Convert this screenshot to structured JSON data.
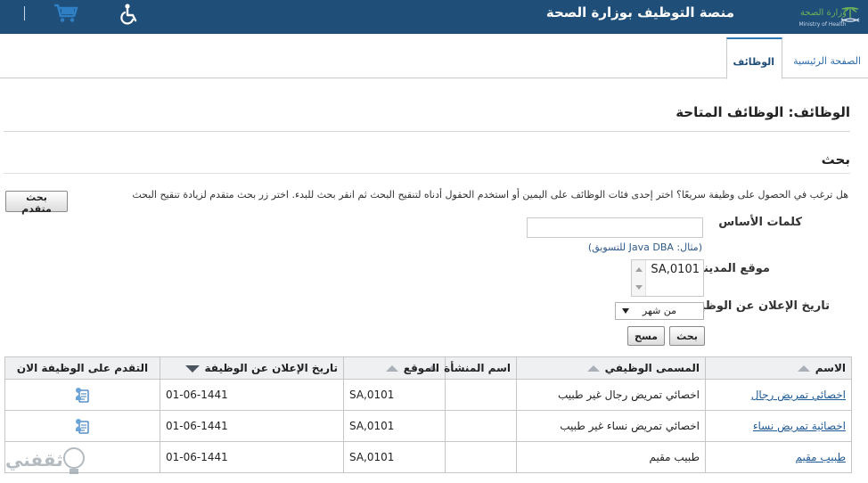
{
  "header": {
    "title": "منصة التوظيف بوزارة الصحة",
    "logo_text": "Ministry of Health",
    "accessibility_icon": "wheelchair-icon",
    "cart_icon": "cart-icon"
  },
  "tabs": [
    {
      "label": "الصفحة الرئيسية",
      "active": false
    },
    {
      "label": "الوظائف",
      "active": true
    }
  ],
  "page": {
    "title": "الوظائف: الوظائف المتاحة",
    "search_title": "بحث",
    "instructions": "هل ترغب في الحصول على وظيفة سريعًا؟ اختر إحدى فئات الوظائف على اليمين أو استخدم الحقول أدناه لتنقيح البحث ثم انقر بحث للبدء. اختر زر بحث متقدم لزيادة تنقيح البحث",
    "advanced_button": "بحث متقدم"
  },
  "search": {
    "keywords_label": "كلمات الأساس",
    "keywords_value": "",
    "keywords_hint": "(مثال: Java DBA للتسويق)",
    "city_label": "موقع المدينة",
    "city_value": "SA,0101",
    "date_label": "تاريخ الإعلان عن الوظيفة",
    "date_value": "من شهر",
    "search_button": "بحث",
    "clear_button": "مسح"
  },
  "table": {
    "headers": [
      "الاسم",
      "المسمى الوظيفي",
      "اسم المنشأة",
      "الموقع",
      "تاريخ الإعلان عن الوظيفة",
      "التقدم على الوظيفة الان"
    ],
    "sorted_column": "تاريخ الإعلان عن الوظيفة",
    "rows": [
      {
        "name": "اخصائي تمريض رجال",
        "title": "اخصائي تمريض رجال غير طبيب",
        "org": "",
        "location": "SA,0101",
        "date": "01-06-1441"
      },
      {
        "name": "اخصائية تمريض نساء",
        "title": "اخصائي تمريض نساء غير طبيب",
        "org": "",
        "location": "SA,0101",
        "date": "01-06-1441"
      },
      {
        "name": "طبيب مقيم",
        "title": "طبيب مقيم",
        "org": "",
        "location": "SA,0101",
        "date": "01-06-1441"
      }
    ],
    "apply_icon": "apply-job-icon"
  },
  "watermark": {
    "text": "ثقفني"
  },
  "colors": {
    "header_bg": "#1f4e79",
    "link": "#1f5a96",
    "tab_accent": "#2f78b8"
  }
}
